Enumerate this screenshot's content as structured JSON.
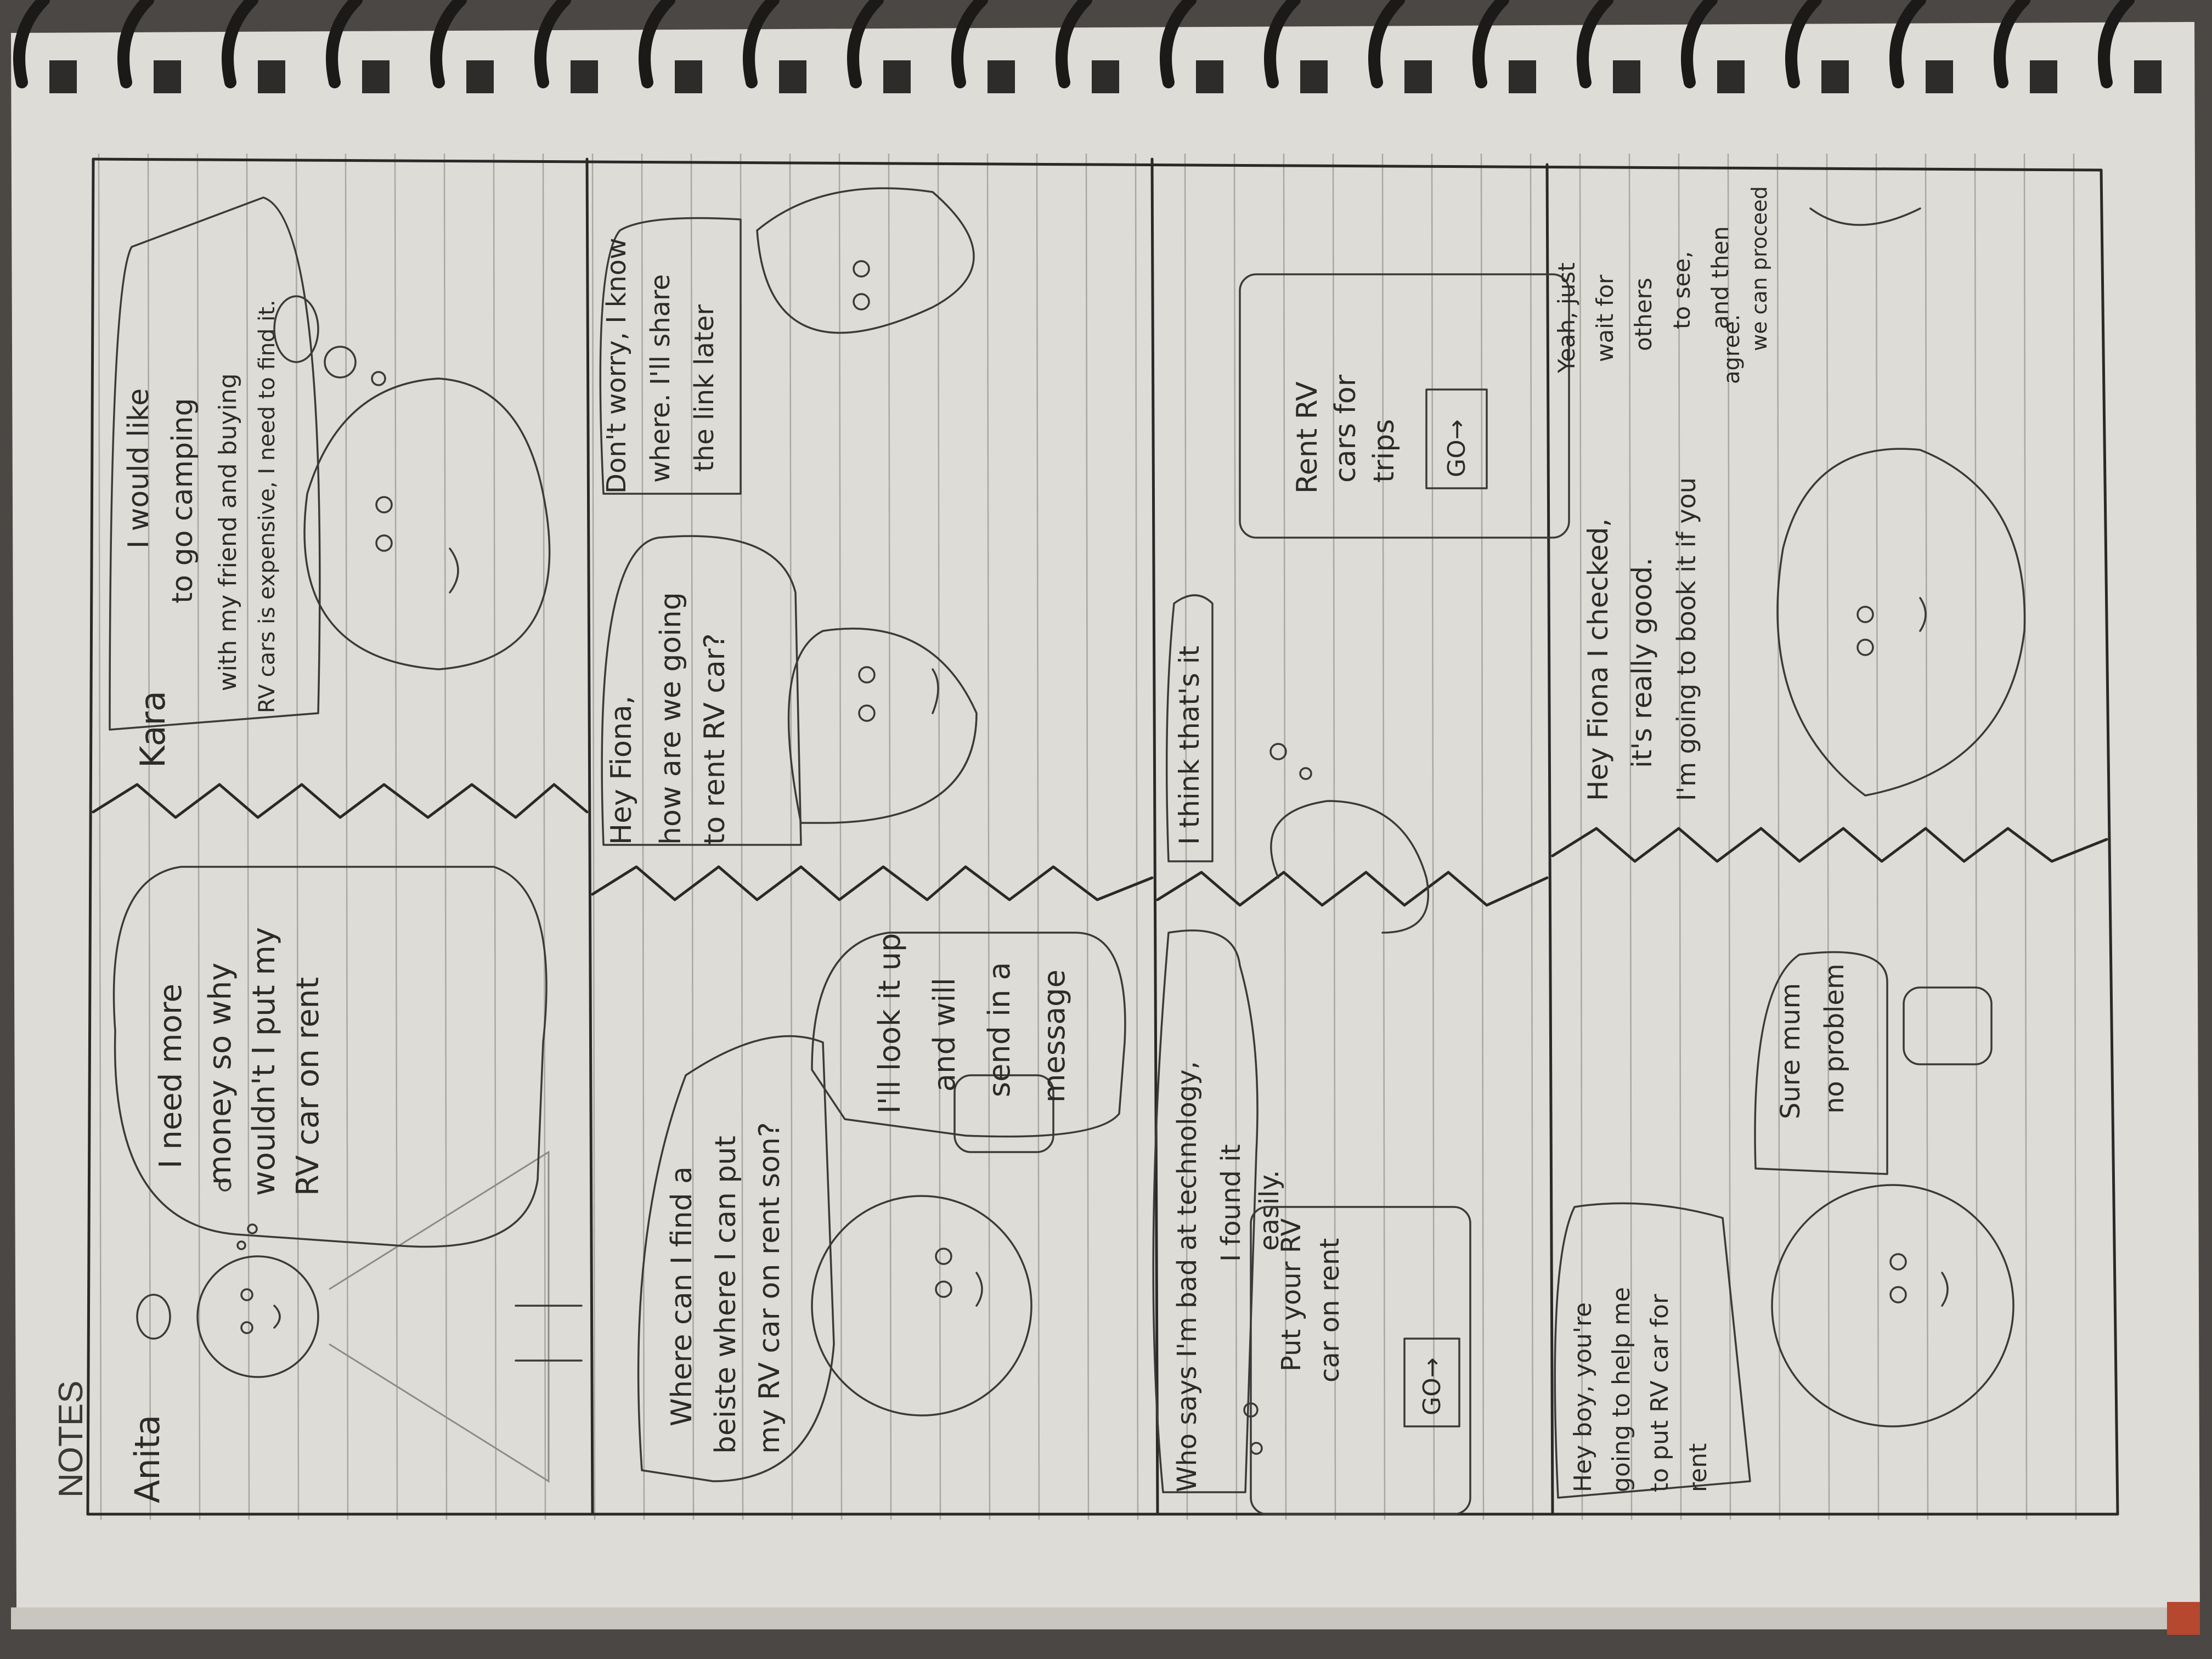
{
  "notebook": {
    "header_label": "NOTES",
    "colors": {
      "paper": "#dedcd7",
      "rule_line": "#a9a7a2",
      "pencil": "#2a2927",
      "spiral": "#1b1a19",
      "background": "#4a4744"
    }
  },
  "comic": {
    "row1": {
      "char_left": "Anita",
      "bubble_left": [
        "I need more",
        "money so why",
        "wouldn't I put my",
        "RV car on rent"
      ],
      "char_right": "Kara",
      "bubble_right": [
        "I would like",
        "to go camping",
        "with my friend and buying",
        "RV cars is expensive, I need to find it."
      ]
    },
    "row2": {
      "bubble_mom": [
        "Where can I find a",
        "beiste where I can put",
        "my RV car on rent son?"
      ],
      "bubble_son": [
        "I'll look it up",
        "and will",
        "send in a",
        "message"
      ],
      "bubble_friend1": [
        "Hey Fiona,",
        "how are we going",
        "to rent RV car?"
      ],
      "bubble_friend2": [
        "Don't worry, I know",
        "where. I'll share",
        "the link later"
      ]
    },
    "row3": {
      "bubble_mom": [
        "Who says I'm bad at technology,",
        "I found it",
        "easily."
      ],
      "screen_left": [
        "Put your RV",
        "car on rent"
      ],
      "go_left": "GO→",
      "thought_right": "I think that's it",
      "screen_right": [
        "Rent RV",
        "cars for",
        "trips"
      ],
      "go_right": "GO→"
    },
    "row4": {
      "bubble_mom": [
        "Hey boy, you're",
        "going to help me",
        "to put RV car for",
        "rent"
      ],
      "bubble_son": [
        "Sure mum",
        "no problem"
      ],
      "bubble_friend1": [
        "Hey Fiona I checked,",
        "it's really good.",
        "I'm going to book it if you",
        "agree."
      ],
      "bubble_friend2": [
        "Yeah, just",
        "wait for",
        "others",
        "to see,",
        "and then",
        "we can proceed"
      ]
    }
  }
}
